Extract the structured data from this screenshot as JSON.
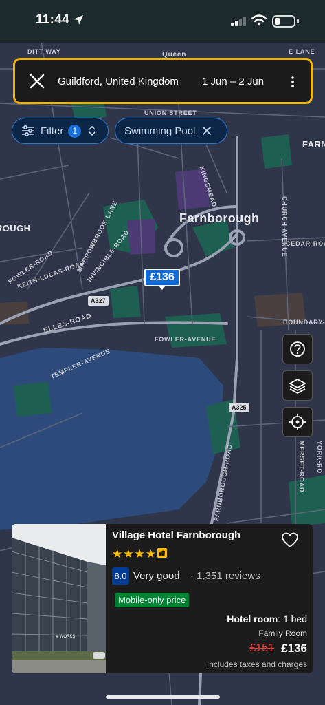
{
  "status_bar": {
    "time": "11:44",
    "icons": [
      "location-arrow-icon",
      "signal-icon",
      "wifi-icon",
      "battery-icon"
    ]
  },
  "search": {
    "destination": "Guildford, United Kingdom",
    "dates": "1 Jun  –  2 Jun",
    "accent_color": "#f5b400"
  },
  "chips": {
    "filter_label": "Filter",
    "filter_count": "1",
    "pool_label": "Swimming Pool"
  },
  "map": {
    "town": "Farnborough",
    "town_left": "ROUGH",
    "town_right": "FARNE",
    "labels": {
      "ditt_way": "DITT-WAY",
      "queen": "Queen",
      "lane": "E-LANE",
      "union_street": "UNION STREET",
      "kingsmead": "KINGSMEAD",
      "church_ave": "CHURCH AVENUE",
      "cedar_road": "CEDAR-ROAD",
      "marrowbrook_lane": "MARROWBROOK LANE",
      "invincible_road": "INVINCIBLE-ROAD",
      "fowler_road": "FOWLER-ROAD",
      "keith_lucas_road": "KEITH-LUCAS-ROAD",
      "elles_road": "ELLES-ROAD",
      "fowler_avenue": "FOWLER-AVENUE",
      "templer_avenue": "TEMPLER-AVENUE",
      "boundary_road": "BOUNDARY-RO",
      "farnborough_road": "FARNBOROUGH-ROAD",
      "somerset_road": "MERSET-ROAD",
      "york_road": "YORK-RO",
      "a327": "A327",
      "a325": "A325"
    },
    "price_pin": "£136",
    "buttons": [
      "help-icon",
      "layers-icon",
      "locate-icon"
    ]
  },
  "hotel": {
    "name": "Village Hotel Farnborough",
    "stars": "★★★★",
    "score": "8.0",
    "score_word": "Very good",
    "reviews": "· 1,351 reviews",
    "badge": "Mobile-only price",
    "room_bold": "Hotel room",
    "room_rest": ": 1 bed",
    "room_sub": "Family Room",
    "price_old": "£151",
    "price_new": "£136",
    "taxes": "Includes taxes and charges",
    "photo_sign": "V WORKS"
  }
}
